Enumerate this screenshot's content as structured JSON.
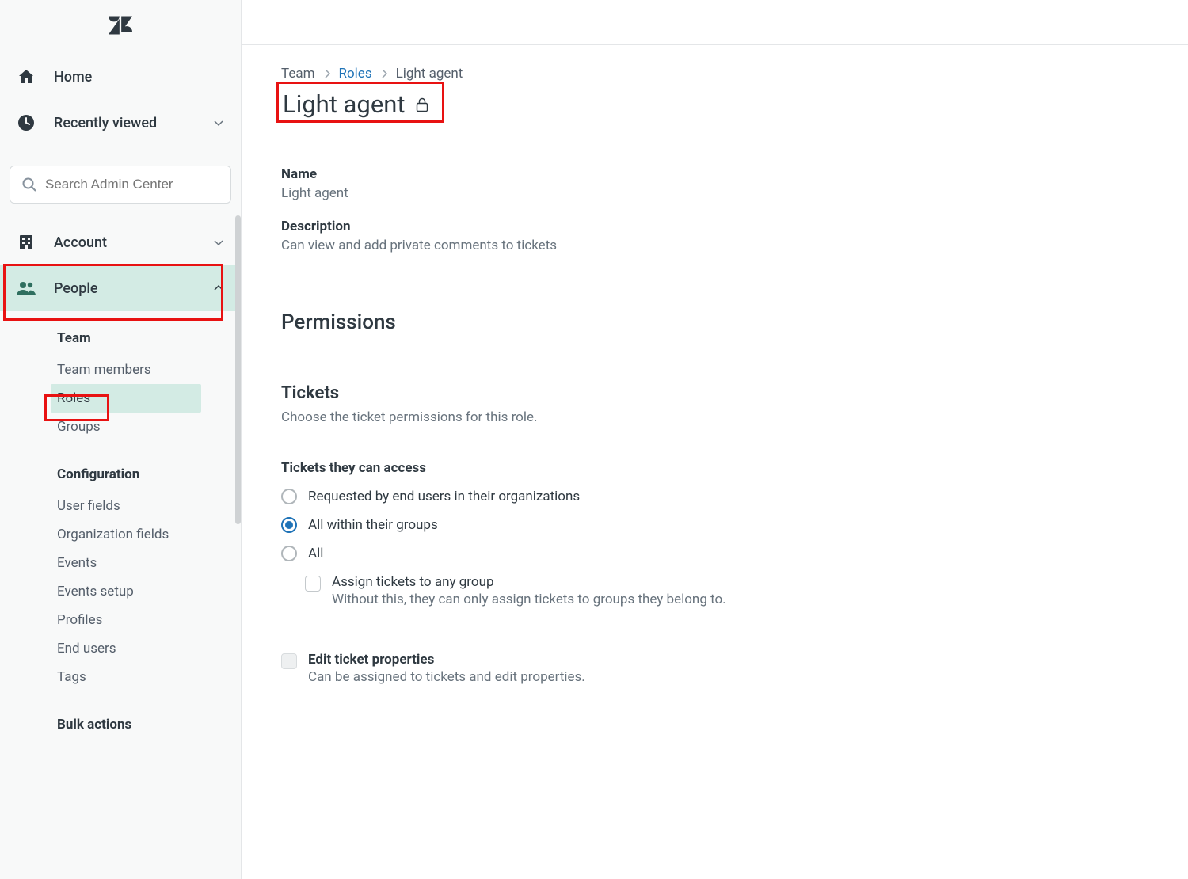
{
  "sidebar": {
    "home": "Home",
    "recent": "Recently viewed",
    "search_placeholder": "Search Admin Center",
    "sections": {
      "account": "Account",
      "people": "People"
    },
    "team_heading": "Team",
    "team_items": [
      "Team members",
      "Roles",
      "Groups"
    ],
    "config_heading": "Configuration",
    "config_items": [
      "User fields",
      "Organization fields",
      "Events",
      "Events setup",
      "Profiles",
      "End users",
      "Tags"
    ],
    "bulk_heading": "Bulk actions"
  },
  "breadcrumb": {
    "team": "Team",
    "roles": "Roles",
    "current": "Light agent"
  },
  "page": {
    "title": "Light agent",
    "name_label": "Name",
    "name_value": "Light agent",
    "desc_label": "Description",
    "desc_value": "Can view and add private comments to tickets"
  },
  "permissions": {
    "heading": "Permissions",
    "tickets_title": "Tickets",
    "tickets_sub": "Choose the ticket permissions for this role.",
    "access_label": "Tickets they can access",
    "access_options": [
      "Requested by end users in their organizations",
      "All within their groups",
      "All"
    ],
    "assign_label": "Assign tickets to any group",
    "assign_help": "Without this, they can only assign tickets to groups they belong to.",
    "edit_label": "Edit ticket properties",
    "edit_help": "Can be assigned to tickets and edit properties."
  }
}
